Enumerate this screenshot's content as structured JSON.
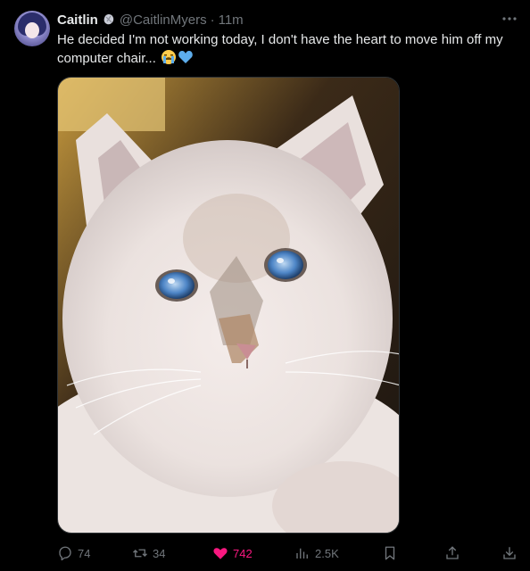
{
  "tweet": {
    "author": {
      "display_name": "Caitlin",
      "handle": "@CaitlinMyers",
      "separator": "·",
      "time": "11m",
      "badge_icon": "shell-badge-icon",
      "avatar_icon": "anime-avatar"
    },
    "text": "He decided I'm not working today, I don't have the heart to move him off my computer chair...",
    "emojis": [
      "crying-face-emoji",
      "blue-heart-emoji"
    ],
    "media": {
      "subject": "fluffy kitten photo",
      "icon": "kitten-photo"
    },
    "more_icon": "more-dots-icon",
    "actions": {
      "replies": "74",
      "reposts": "34",
      "likes": "742",
      "views": "2.5K",
      "bookmark_icon": "bookmark-icon",
      "share_icon": "share-icon",
      "download_icon": "download-icon"
    },
    "colors": {
      "background": "#000000",
      "text": "#e7e9ea",
      "muted": "#71767b",
      "like": "#f91880",
      "border": "#2f3336"
    }
  }
}
